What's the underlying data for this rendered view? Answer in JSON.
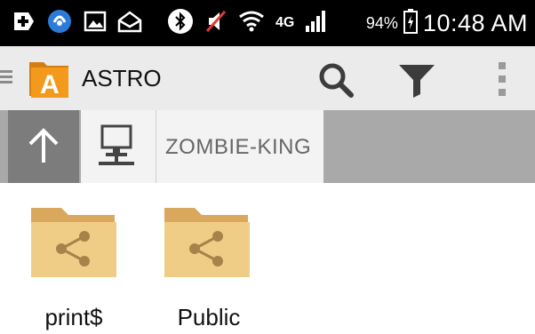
{
  "status_bar": {
    "icons": [
      "plus-box-icon",
      "signal-logo-icon",
      "gallery-icon",
      "mail-icon",
      "bluetooth-icon",
      "mute-icon",
      "wifi-icon",
      "lte-icon",
      "signal-bars-icon"
    ],
    "lte_label": "4G",
    "battery_percent": "94%",
    "time": "10:48 AM"
  },
  "app_bar": {
    "title": "ASTRO",
    "logo_letter": "A",
    "actions": [
      "search-icon",
      "filter-icon",
      "overflow-menu-icon"
    ]
  },
  "path_bar": {
    "host": "ZOMBIE-KING"
  },
  "files": [
    {
      "name": "print$",
      "icon": "shared-folder-icon"
    },
    {
      "name": "Public",
      "icon": "shared-folder-icon"
    }
  ],
  "colors": {
    "status_bar": "#000000",
    "app_bar": "#ebebeb",
    "path_bar": "#a9a9a9",
    "up_button": "#7c7c7c",
    "logo_orange": "#f39a1d",
    "folder": "#f0cd87"
  }
}
